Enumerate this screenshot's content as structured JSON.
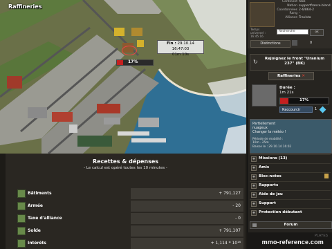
{
  "map": {
    "title": "Raffineries",
    "tooltip_line1_label": "Fin :",
    "tooltip_line1_value": "29.10.14 16:47:03",
    "tooltip_line2": "01m 10s",
    "progress_percent": 17,
    "progress_label": "17%"
  },
  "finances": {
    "title": "Recettes & dépenses",
    "subtitle": "- Le calcul est opéré toutes les 10 minutes -",
    "rows": [
      {
        "label": "Bâtiments",
        "value": "+ 791,127"
      },
      {
        "label": "Armée",
        "value": "- 20"
      },
      {
        "label": "Taxe d'alliance",
        "value": "- 0"
      },
      {
        "label": "Solde",
        "value": "+ 791,107"
      },
      {
        "label": "Intérêts",
        "value": "+ 1,114 * 10¹⁸"
      }
    ]
  },
  "profile": {
    "stats": [
      {
        "k": "Continent",
        "v": "Alké"
      },
      {
        "k": "Nation",
        "v": "supportfrance.bland"
      },
      {
        "k": "Coordonnées",
        "v": "2-6/864-2"
      },
      {
        "k": "Rang",
        "v": "-"
      },
      {
        "k": "Alliance",
        "v": "Travista"
      }
    ],
    "chat_line1": "Temps",
    "chat_line2": "universel :",
    "chat_line3": "16:45:16",
    "search_placeholder": "Recherche",
    "search_button": "ok",
    "distinctions_label": "Distinctions",
    "count": "0"
  },
  "sidebar": {
    "front_label": "Rejoignez le front \"Uranium 237\" (BK)",
    "refineries_label": "Raffineries",
    "duration_label": "Durée :",
    "duration_value": "1m 21s",
    "progress_percent": 17,
    "progress_label": "17%",
    "shorten_label": "Raccourcir",
    "shorten_count": "1",
    "weather_line1": "Partiellement nuageux",
    "weather_line2": "Changer la météo !",
    "weather_line3": "Période de mobilité :",
    "weather_line4": "10m - 25m",
    "weather_line5": "Baisse le : 29.10.14 16:02",
    "menu": [
      {
        "label": "Missions (13)",
        "bullet": "+"
      },
      {
        "label": "Amis",
        "bullet": "+"
      },
      {
        "label": "Bloc-notes",
        "bullet": "+"
      },
      {
        "label": "Rapports",
        "bullet": "+"
      },
      {
        "label": "Aide de jeu",
        "bullet": "+"
      },
      {
        "label": "Support",
        "bullet": "+"
      },
      {
        "label": "Protection débutant",
        "bullet": "+"
      }
    ],
    "forum_label": "Forum"
  },
  "footer": {
    "watermark": "mmo-reference.com",
    "logo": "PLAYES"
  },
  "colors": {
    "progress": "#c42020",
    "panel": "#2a2722",
    "water": "#2f6f94"
  }
}
